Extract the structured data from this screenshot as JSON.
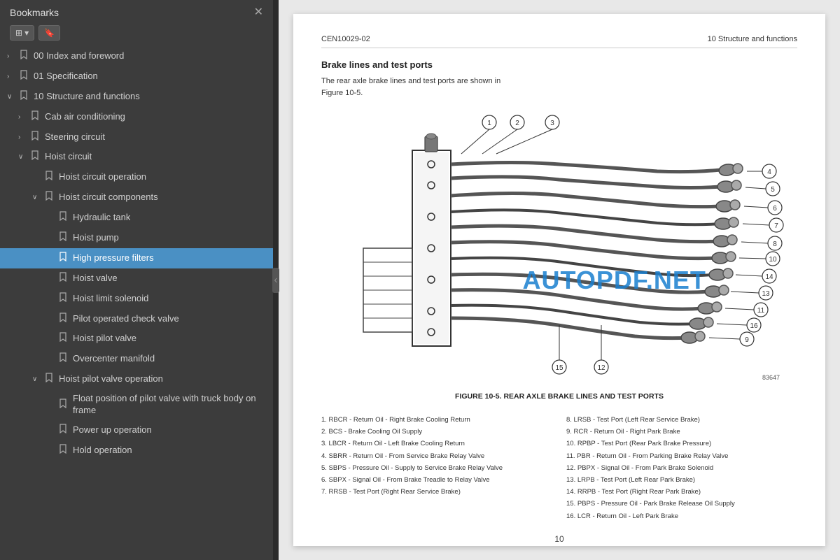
{
  "sidebar": {
    "title": "Bookmarks",
    "toolbar": {
      "expand_label": "⊞ ▾",
      "bookmark_icon_label": "🔖"
    },
    "tree": [
      {
        "id": "00-index",
        "label": "00 Index and foreword",
        "level": 0,
        "arrow": "›",
        "expanded": false,
        "selected": false
      },
      {
        "id": "01-spec",
        "label": "01 Specification",
        "level": 0,
        "arrow": "›",
        "expanded": false,
        "selected": false
      },
      {
        "id": "10-struct",
        "label": "10 Structure and functions",
        "level": 0,
        "arrow": "∨",
        "expanded": true,
        "selected": false
      },
      {
        "id": "cab-ac",
        "label": "Cab air conditioning",
        "level": 1,
        "arrow": "›",
        "expanded": false,
        "selected": false
      },
      {
        "id": "steering",
        "label": "Steering circuit",
        "level": 1,
        "arrow": "›",
        "expanded": false,
        "selected": false
      },
      {
        "id": "hoist-circuit",
        "label": "Hoist circuit",
        "level": 1,
        "arrow": "∨",
        "expanded": true,
        "selected": false
      },
      {
        "id": "hoist-op",
        "label": "Hoist circuit operation",
        "level": 2,
        "arrow": "",
        "expanded": false,
        "selected": false
      },
      {
        "id": "hoist-comp",
        "label": "Hoist circuit components",
        "level": 2,
        "arrow": "∨",
        "expanded": true,
        "selected": false
      },
      {
        "id": "hydraulic-tank",
        "label": "Hydraulic tank",
        "level": 3,
        "arrow": "",
        "expanded": false,
        "selected": false
      },
      {
        "id": "hoist-pump",
        "label": "Hoist pump",
        "level": 3,
        "arrow": "",
        "expanded": false,
        "selected": false
      },
      {
        "id": "high-pressure",
        "label": "High pressure filters",
        "level": 3,
        "arrow": "",
        "expanded": false,
        "selected": true
      },
      {
        "id": "hoist-valve",
        "label": "Hoist valve",
        "level": 3,
        "arrow": "",
        "expanded": false,
        "selected": false
      },
      {
        "id": "hoist-limit",
        "label": "Hoist limit solenoid",
        "level": 3,
        "arrow": "",
        "expanded": false,
        "selected": false
      },
      {
        "id": "pilot-check",
        "label": "Pilot operated check valve",
        "level": 3,
        "arrow": "",
        "expanded": false,
        "selected": false
      },
      {
        "id": "hoist-pilot",
        "label": "Hoist pilot valve",
        "level": 3,
        "arrow": "",
        "expanded": false,
        "selected": false
      },
      {
        "id": "overcenter",
        "label": "Overcenter manifold",
        "level": 3,
        "arrow": "",
        "expanded": false,
        "selected": false
      },
      {
        "id": "hoist-pilot-op",
        "label": "Hoist pilot valve operation",
        "level": 2,
        "arrow": "∨",
        "expanded": true,
        "selected": false
      },
      {
        "id": "float-pos",
        "label": "Float position of pilot valve with truck body on frame",
        "level": 3,
        "arrow": "",
        "expanded": false,
        "selected": false,
        "multiline": true
      },
      {
        "id": "power-up",
        "label": "Power up operation",
        "level": 3,
        "arrow": "",
        "expanded": false,
        "selected": false
      },
      {
        "id": "hold-op",
        "label": "Hold operation",
        "level": 3,
        "arrow": "",
        "expanded": false,
        "selected": false
      }
    ]
  },
  "document": {
    "header_left": "CEN10029-02",
    "header_right": "10 Structure and functions",
    "section_title": "Brake lines and test ports",
    "body_text": "The rear axle brake lines and test ports are shown in Figure 10-5.",
    "figure_caption": "FIGURE 10-5. REAR AXLE BRAKE LINES AND TEST PORTS",
    "watermark": "AUTOPDF.NET",
    "page_number": "10",
    "figure_number": "83647",
    "legend": {
      "left_col": [
        "1. RBCR - Return Oil - Right Brake Cooling Return",
        "2. BCS - Brake Cooling Oil Supply",
        "3. LBCR - Return Oil - Left Brake Cooling Return",
        "4. SBRR - Return Oil - From Service Brake Relay Valve",
        "5. SBPS - Pressure Oil - Supply to Service Brake Relay Valve",
        "6. SBPX - Signal Oil - From Brake Treadle to Relay Valve",
        "7. RRSB - Test Port (Right Rear Service Brake)"
      ],
      "right_col": [
        "8. LRSB - Test Port (Left Rear Service Brake)",
        "9. RCR - Return Oil - Right Park Brake",
        "10. RPBP - Test Port (Rear Park Brake Pressure)",
        "11. PBR - Return Oil - From Parking Brake Relay Valve",
        "12. PBPX - Signal Oil - From Park Brake Solenoid",
        "13. LRPB - Test Port (Left Rear Park Brake)",
        "14. RRPB - Test Port (Right Rear Park Brake)",
        "15. PBPS - Pressure Oil - Park Brake Release Oil Supply",
        "16. LCR - Return Oil - Left Park Brake"
      ]
    }
  }
}
